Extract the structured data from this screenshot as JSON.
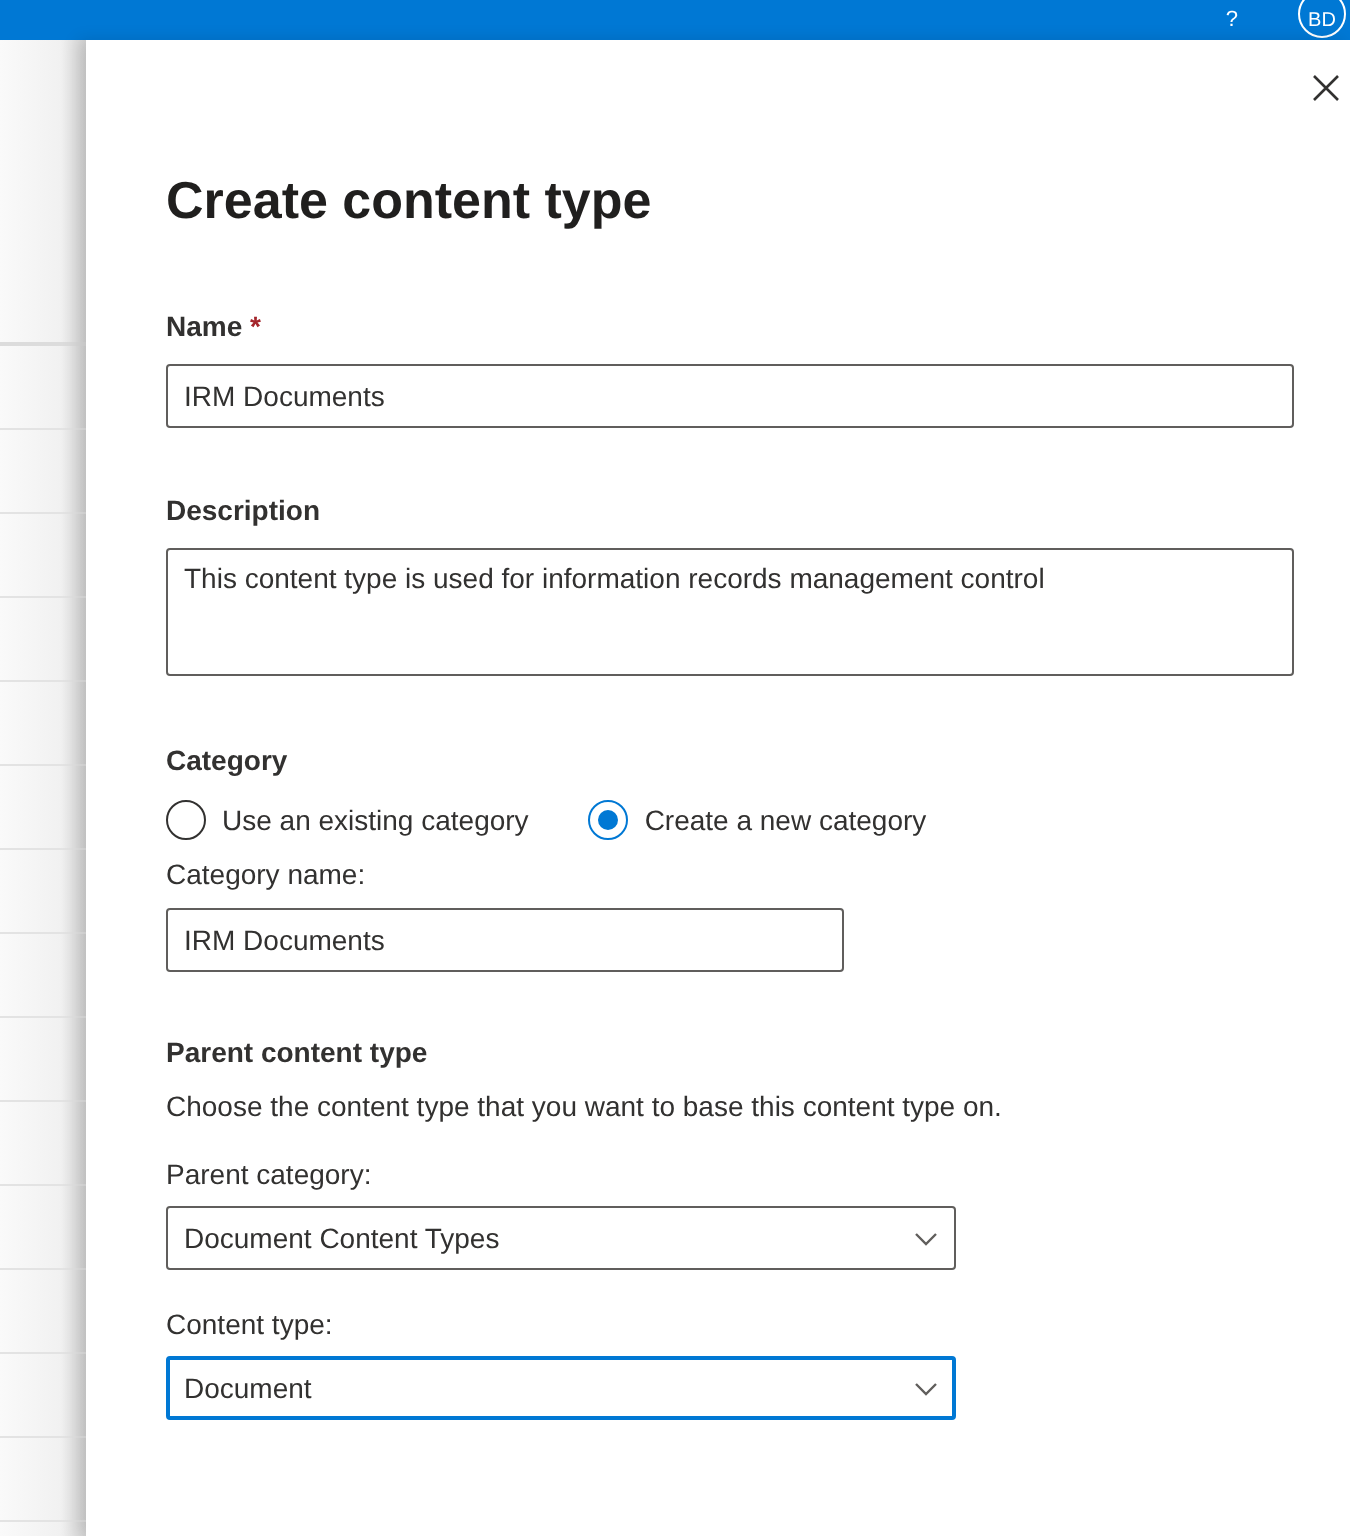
{
  "top_bar": {
    "help_mark": "?",
    "avatar_initials": "BD"
  },
  "panel": {
    "title": "Create content type",
    "name": {
      "label": "Name",
      "required_mark": "*",
      "value": "IRM Documents"
    },
    "description": {
      "label": "Description",
      "value": "This content type is used for information records management control"
    },
    "category": {
      "label": "Category",
      "options": [
        {
          "label": "Use an existing category",
          "selected": false
        },
        {
          "label": "Create a new category",
          "selected": true
        }
      ],
      "name_field": {
        "label": "Category name:",
        "value": "IRM Documents"
      }
    },
    "parent": {
      "heading": "Parent content type",
      "description": "Choose the content type that you want to base this content type on.",
      "selects": [
        {
          "label": "Parent category:",
          "value": "Document Content Types",
          "focused": false
        },
        {
          "label": "Content type:",
          "value": "Document",
          "focused": true
        }
      ]
    }
  }
}
